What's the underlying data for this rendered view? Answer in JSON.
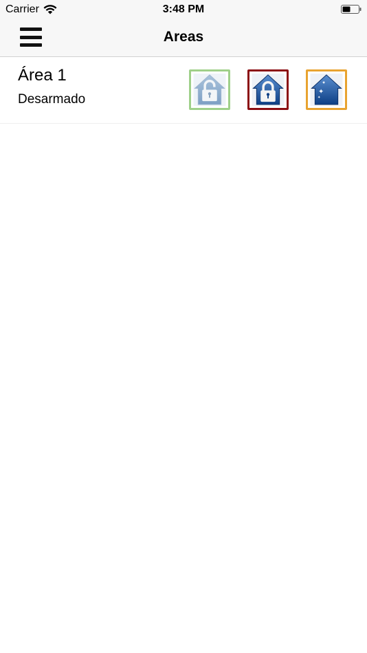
{
  "status_bar": {
    "carrier": "Carrier",
    "time": "3:48 PM",
    "battery_level": 0.5
  },
  "navbar": {
    "title": "Areas",
    "menu_icon": "hamburger-menu-icon"
  },
  "areas": [
    {
      "name": "Área 1",
      "status": "Desarmado",
      "buttons": [
        {
          "icon": "house-unlocked-icon",
          "border_color": "#9fd08a"
        },
        {
          "icon": "house-locked-icon",
          "border_color": "#8b0d12"
        },
        {
          "icon": "house-night-icon",
          "border_color": "#e8a330"
        }
      ]
    }
  ]
}
